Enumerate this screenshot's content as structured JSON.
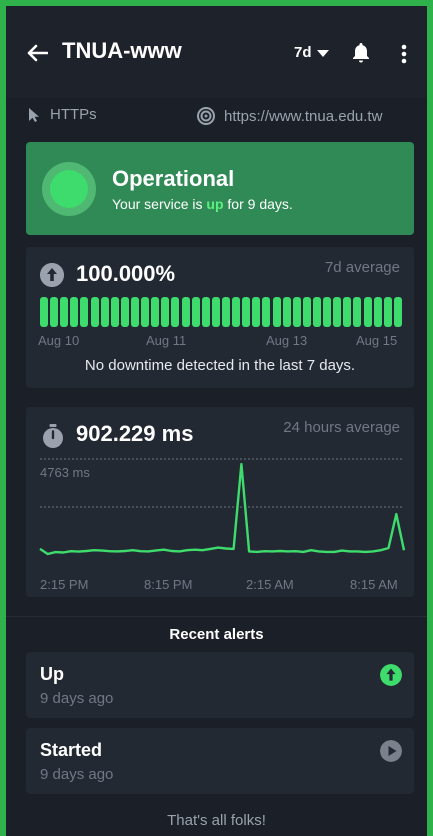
{
  "app": {
    "title": "TNUA-www",
    "range": "7d"
  },
  "monitor": {
    "protocol": "HTTPs",
    "url": "https://www.tnua.edu.tw"
  },
  "status": {
    "title": "Operational",
    "sub_prefix": "Your service is ",
    "sub_state": "up",
    "sub_suffix": " for 9 days."
  },
  "uptime": {
    "value": "100.000%",
    "avg_label": "7d average",
    "bar_count": 36,
    "day_labels": [
      "Aug 10",
      "Aug 11",
      "Aug 13",
      "Aug 15"
    ],
    "note": "No downtime detected in the last 7 days."
  },
  "response": {
    "value": "902.229 ms",
    "avg_label": "24 hours average",
    "max_label": "4763 ms",
    "time_labels": [
      "2:15 PM",
      "8:15 PM",
      "2:15 AM",
      "8:15 AM"
    ]
  },
  "chart_data": {
    "type": "line",
    "title": "",
    "ylabel": "",
    "xlabel": "",
    "x": [
      "2:15 PM",
      "8:15 PM",
      "2:15 AM",
      "8:15 AM"
    ],
    "ylim": [
      0,
      5000
    ],
    "series": [
      {
        "values": [
          760,
          520,
          610,
          590,
          650,
          630,
          660,
          700,
          680,
          650,
          640,
          660,
          700,
          650,
          640,
          690,
          720,
          660,
          640,
          700,
          720,
          700,
          760,
          820,
          780,
          760,
          4760,
          640,
          620,
          650,
          640,
          660,
          640,
          650,
          620,
          700,
          640,
          620,
          620,
          680,
          640,
          640,
          620,
          640,
          700,
          800,
          2400,
          700
        ]
      }
    ]
  },
  "recent": {
    "title": "Recent alerts",
    "alerts": [
      {
        "title": "Up",
        "time": "9 days ago",
        "icon": "up-arrow-icon",
        "color": "#3ddc6c"
      },
      {
        "title": "Started",
        "time": "9 days ago",
        "icon": "play-icon",
        "color": "#7a818c"
      }
    ],
    "footer": "That's all folks!"
  }
}
